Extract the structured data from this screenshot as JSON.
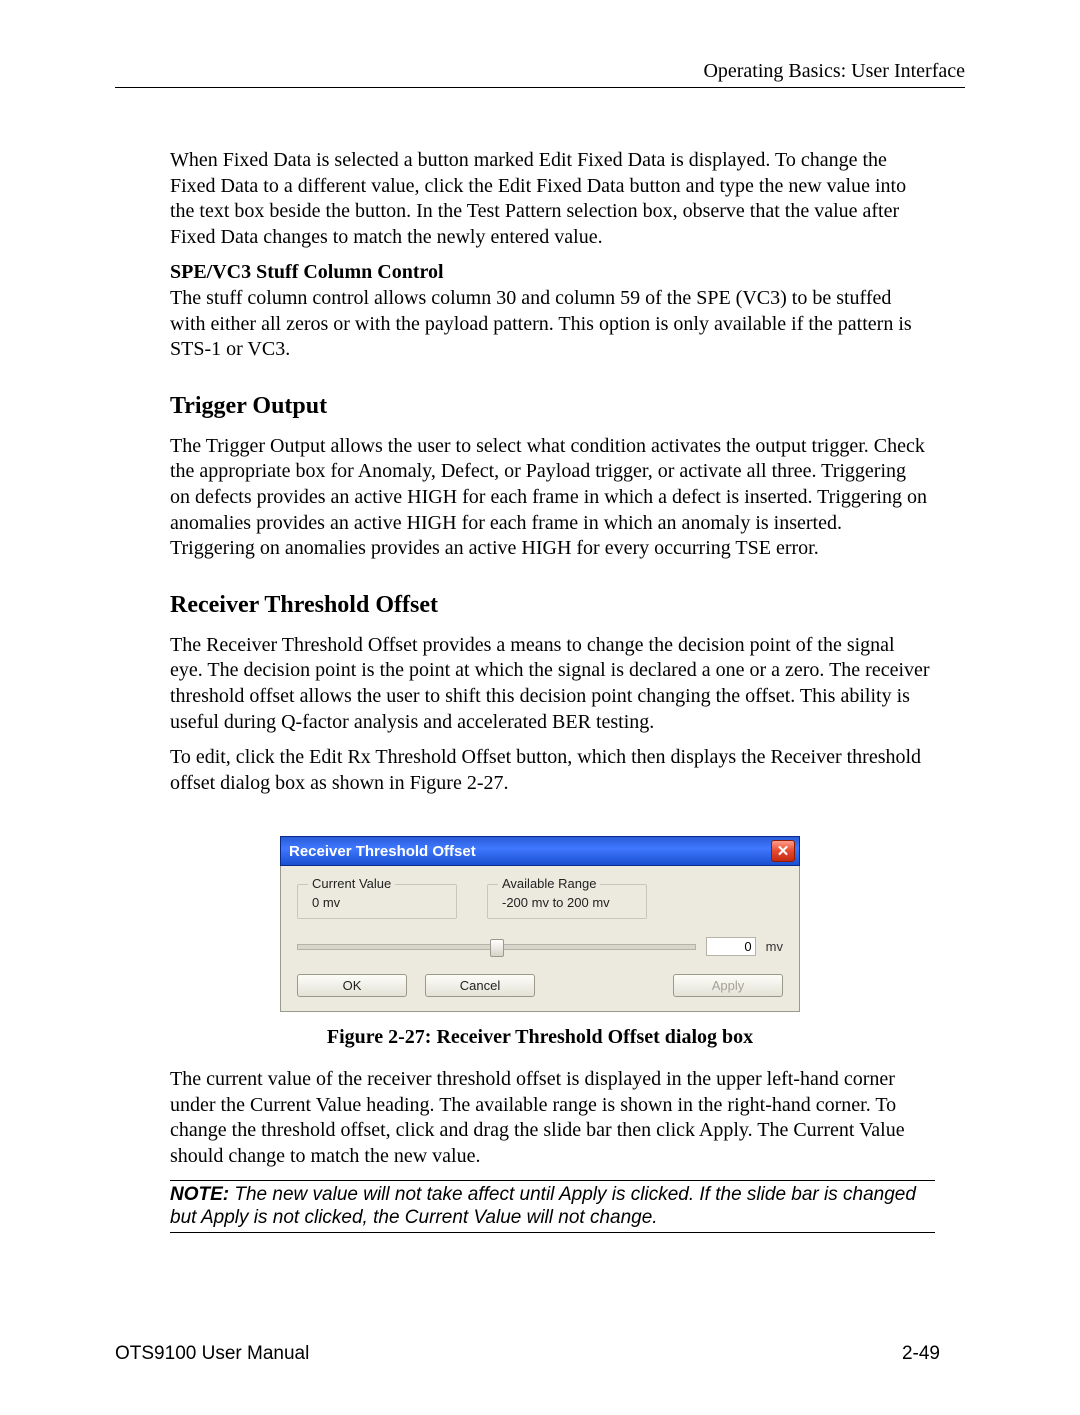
{
  "header": {
    "section_path": "Operating Basics: User Interface"
  },
  "body": {
    "p1": "When Fixed Data is selected a button marked Edit Fixed Data is displayed.  To change the Fixed Data to a different value, click the Edit Fixed Data button and type the new value into the text box beside the button.  In the Test Pattern selection box, observe that the value after Fixed Data changes to match the newly entered value.",
    "sub_head_1": "SPE/VC3 Stuff Column Control",
    "p2": "The stuff column control allows column 30 and column 59 of the SPE (VC3) to be stuffed with either all zeros or with the payload pattern.  This option is only available if the pattern is STS-1 or VC3.",
    "h_trigger": "Trigger Output",
    "p3": "The Trigger Output allows the user to select what condition activates the output trigger.  Check the appropriate box for Anomaly, Defect, or Payload trigger, or activate all three.  Triggering on defects provides an active HIGH for each frame in which a defect is inserted.  Triggering on anomalies provides an active HIGH for each frame in which an anomaly is inserted.  Triggering on anomalies provides an active HIGH for every occurring TSE error.",
    "h_rx": "Receiver Threshold Offset",
    "p4": "The Receiver Threshold Offset provides a means to change the decision point of the signal eye.  The decision point is the point at which the signal is declared a one or a zero.  The receiver threshold offset allows the user to shift this decision point changing the offset.  This ability is useful during Q-factor analysis and accelerated BER testing.",
    "p5": "To edit, click the Edit Rx Threshold Offset button, which then displays the Receiver threshold offset dialog box as shown in Figure 2-27.",
    "fig_caption": "Figure 2-27: Receiver Threshold Offset dialog box",
    "p6": "The current value of the receiver threshold offset is displayed in the upper left-hand corner under the Current Value heading.  The available range is shown in the right-hand corner.  To change the threshold offset, click and drag the slide bar then click Apply.  The Current Value should change to match the new value.",
    "note_label": "NOTE:",
    "note_body": " The new value will not take affect until Apply is clicked.  If the slide bar is changed but Apply is not clicked, the Current Value will not change."
  },
  "dialog": {
    "title": "Receiver Threshold Offset",
    "current_value_label": "Current Value",
    "current_value": "0 mv",
    "range_label": "Available Range",
    "range_value": "-200 mv to 200 mv",
    "slider_value": "0",
    "unit": "mv",
    "ok": "OK",
    "cancel": "Cancel",
    "apply": "Apply"
  },
  "footer": {
    "manual": "OTS9100 User Manual",
    "page_no": "2-49"
  }
}
